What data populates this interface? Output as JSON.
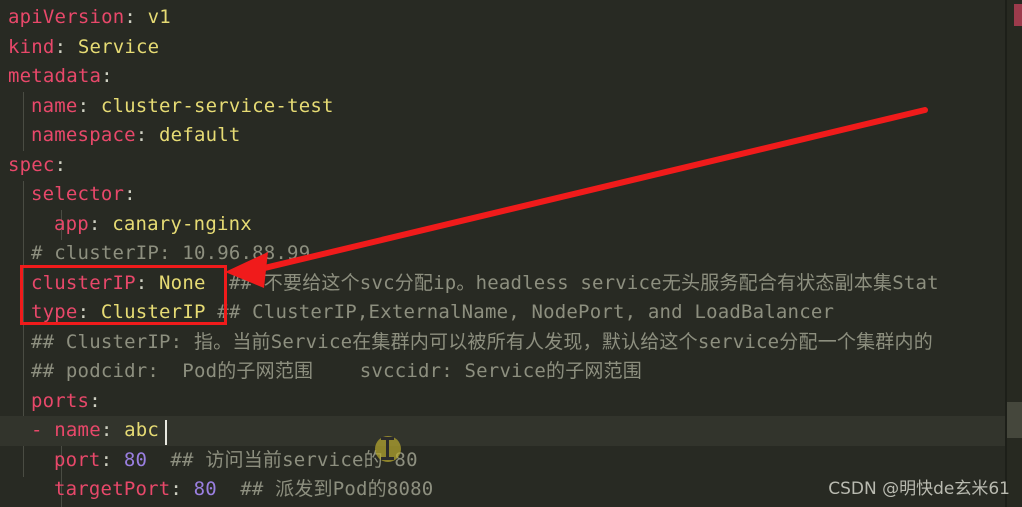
{
  "editor": {
    "theme": {
      "background": "#282a23",
      "active_line_background": "#32342c",
      "key_color": "#e8486a",
      "string_color": "#e6db74",
      "number_color": "#9a7fe0",
      "comment_color": "#8d8f7f",
      "punctuation_color": "#cfd0c2",
      "caret_color": "#e8e8e0"
    },
    "lines": [
      {
        "key": "apiVersion",
        "value": "v1",
        "indent": 0,
        "type": "pair"
      },
      {
        "key": "kind",
        "value": "Service",
        "indent": 0,
        "type": "pair"
      },
      {
        "key": "metadata",
        "value": "",
        "indent": 0,
        "type": "map"
      },
      {
        "key": "name",
        "value": "cluster-service-test",
        "indent": 1,
        "type": "pair"
      },
      {
        "key": "namespace",
        "value": "default",
        "indent": 1,
        "type": "pair"
      },
      {
        "key": "spec",
        "value": "",
        "indent": 0,
        "type": "map"
      },
      {
        "key": "selector",
        "value": "",
        "indent": 1,
        "type": "map"
      },
      {
        "key": "app",
        "value": "canary-nginx",
        "indent": 2,
        "type": "pair"
      },
      {
        "comment": "# clusterIP: 10.96.88.99",
        "indent": 1,
        "type": "comment"
      },
      {
        "key": "clusterIP",
        "value": "None",
        "indent": 1,
        "type": "pair",
        "trailing_comment": "## 不要给这个svc分配ip。headless service无头服务配合有状态副本集Stat"
      },
      {
        "key": "type",
        "value": "ClusterIP",
        "indent": 1,
        "type": "pair",
        "trailing_comment": "## ClusterIP,ExternalName, NodePort, and LoadBalancer"
      },
      {
        "comment": "## ClusterIP: 指。当前Service在集群内可以被所有人发现，默认给这个service分配一个集群内的",
        "indent": 1,
        "type": "comment"
      },
      {
        "comment": "## podcidr:  Pod的子网范围    svccidr: Service的子网范围",
        "indent": 1,
        "type": "comment"
      },
      {
        "key": "ports",
        "value": "",
        "indent": 1,
        "type": "map"
      },
      {
        "key": "name",
        "value": "abc",
        "indent": 1,
        "type": "pair",
        "list_item": true,
        "active": true
      },
      {
        "key": "port",
        "value": "80",
        "indent": 2,
        "type": "pair",
        "number": true,
        "trailing_comment": "## 访问当前service的 80"
      },
      {
        "key": "targetPort",
        "value": "80",
        "indent": 2,
        "type": "pair",
        "number": true,
        "trailing_comment": "## 派发到Pod的8080"
      }
    ],
    "caret": {
      "after_text": "abc",
      "line_index": 14
    }
  },
  "annotations": {
    "box": {
      "label": "red-highlight-box",
      "color": "#f01b1b",
      "covers": [
        "clusterIP: None",
        "type: ClusterIP"
      ]
    },
    "arrow": {
      "label": "red-pointer-arrow",
      "color": "#f01b1b",
      "points_to": "clusterIP: None"
    }
  },
  "mouse": {
    "cursor_type": "text-ibeam"
  },
  "watermark": {
    "text": "CSDN @明快de玄米61"
  },
  "rail": {
    "error_mark": true,
    "thumb": true
  }
}
